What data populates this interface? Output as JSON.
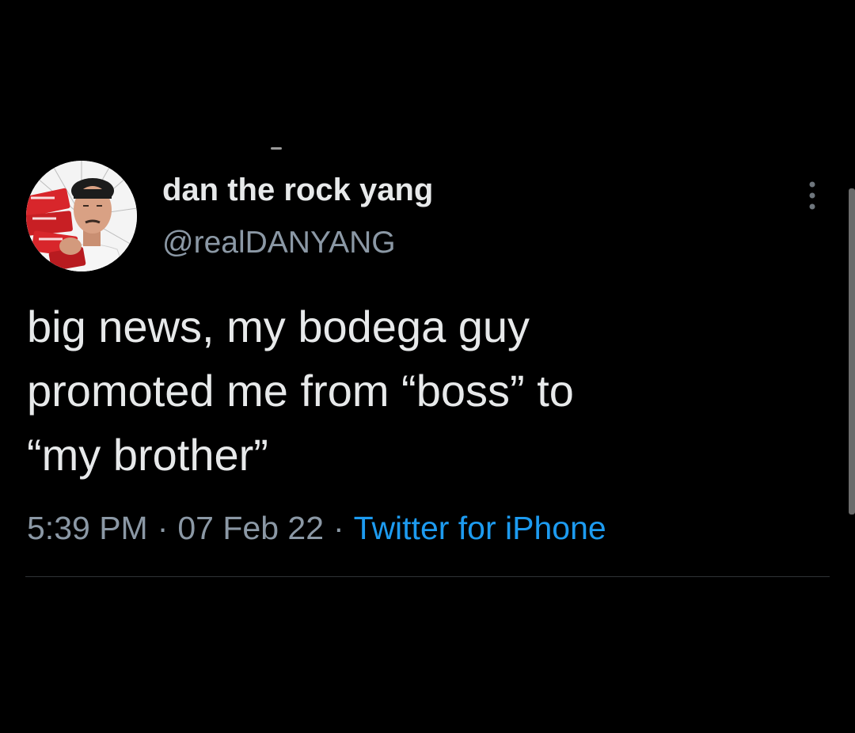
{
  "tweet": {
    "author": {
      "display_name": "dan the rock yang",
      "handle": "@realDANYANG",
      "avatar_icon": "profile-photo"
    },
    "text_lines": [
      "big news, my bodega guy",
      "promoted me from “boss” to",
      "“my brother”"
    ],
    "meta": {
      "time": "5:39 PM",
      "date": "07 Feb 22",
      "separator": "·",
      "source": "Twitter for iPhone"
    },
    "more_icon": "more-vertical-icon"
  },
  "colors": {
    "background": "#000000",
    "text_primary": "#e7e9ea",
    "text_secondary": "#8b98a5",
    "link": "#1d9bf0",
    "divider": "#2f3336"
  }
}
